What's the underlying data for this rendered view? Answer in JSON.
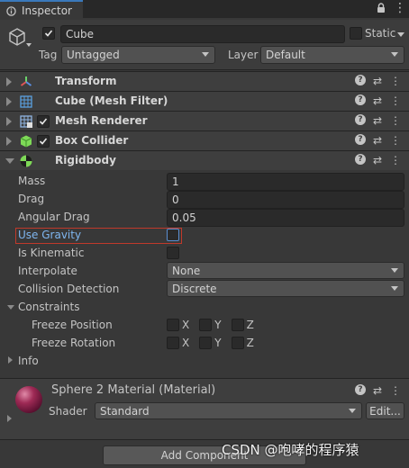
{
  "tab": {
    "label": "Inspector"
  },
  "header": {
    "object_name": "Cube",
    "active": true,
    "static_label": "Static",
    "tag_label": "Tag",
    "tag_value": "Untagged",
    "layer_label": "Layer",
    "layer_value": "Default"
  },
  "components": [
    {
      "name": "Transform",
      "icon": "transform-icon",
      "has_checkbox": false
    },
    {
      "name": "Cube (Mesh Filter)",
      "icon": "mesh-filter-icon",
      "has_checkbox": false
    },
    {
      "name": "Mesh Renderer",
      "icon": "mesh-renderer-icon",
      "has_checkbox": true
    },
    {
      "name": "Box Collider",
      "icon": "box-collider-icon",
      "has_checkbox": true
    },
    {
      "name": "Rigidbody",
      "icon": "rigidbody-icon",
      "has_checkbox": false
    }
  ],
  "rigidbody": {
    "mass_label": "Mass",
    "mass": "1",
    "drag_label": "Drag",
    "drag": "0",
    "angular_drag_label": "Angular Drag",
    "angular_drag": "0.05",
    "use_gravity_label": "Use Gravity",
    "is_kinematic_label": "Is Kinematic",
    "interpolate_label": "Interpolate",
    "interpolate": "None",
    "collision_label": "Collision Detection",
    "collision": "Discrete",
    "constraints_label": "Constraints",
    "freeze_position_label": "Freeze Position",
    "freeze_rotation_label": "Freeze Rotation",
    "axes": [
      "X",
      "Y",
      "Z"
    ],
    "info_label": "Info"
  },
  "material": {
    "name": "Sphere 2 Material (Material)",
    "shader_label": "Shader",
    "shader": "Standard",
    "edit_label": "Edit..."
  },
  "footer": {
    "add_component": "Add Component"
  },
  "watermark": "CSDN @咆哮的程序猿",
  "colors": {
    "accent": "#3a79bb",
    "highlight_border": "#c0392b",
    "background": "#383838"
  }
}
